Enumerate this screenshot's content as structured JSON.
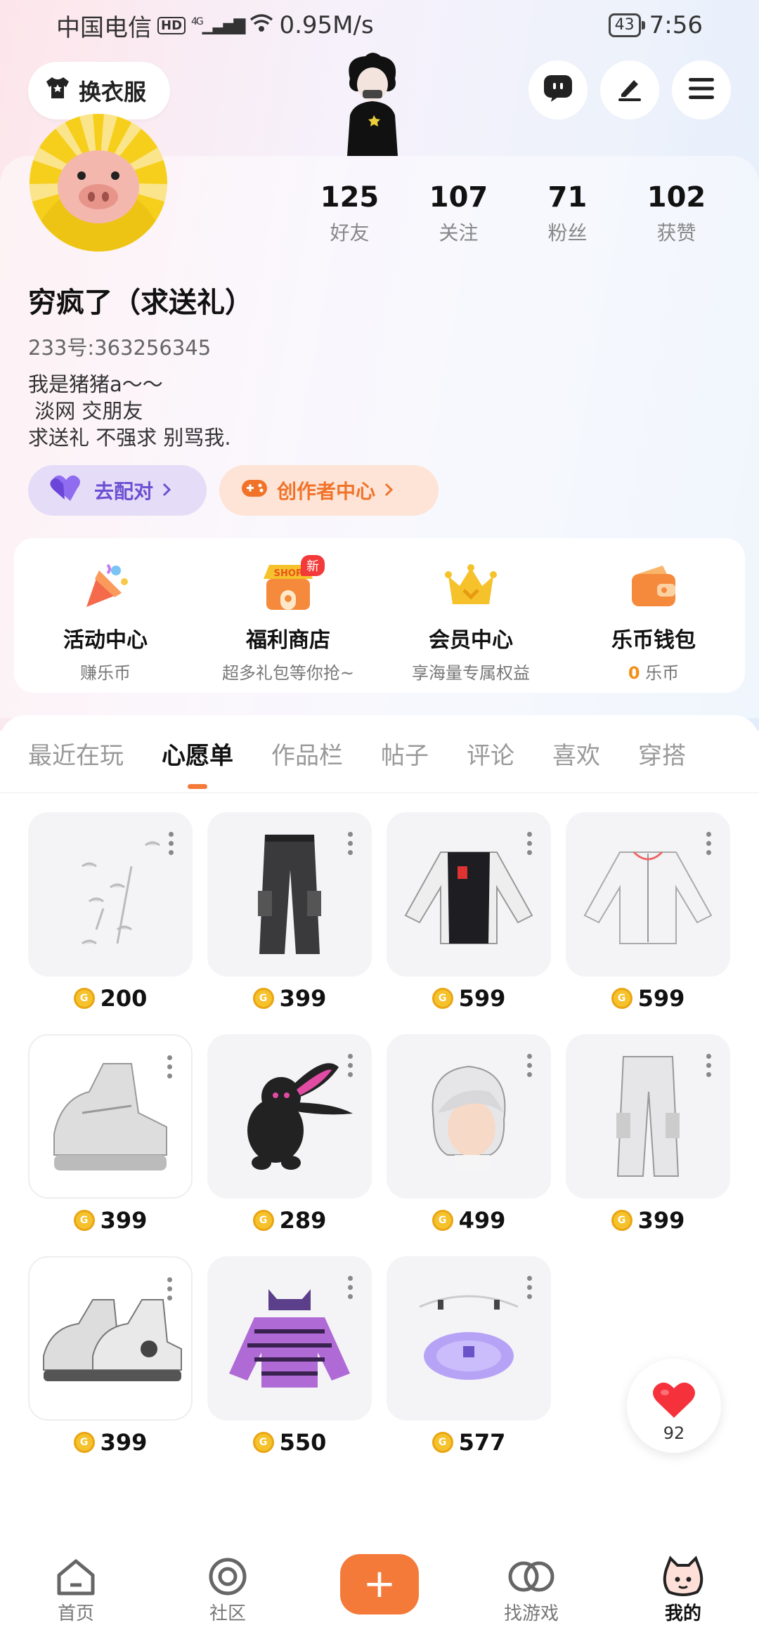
{
  "status_bar": {
    "carrier": "中国电信",
    "hd": "HD",
    "network": "4G",
    "speed": "0.95M/s",
    "battery": "43",
    "time": "7:56"
  },
  "header": {
    "wardrobe_label": "换衣服"
  },
  "profile": {
    "nickname": "穷疯了（求送礼）",
    "uid": "233号:363256345",
    "bio": "我是猪猪a～～\n 淡网 交朋友\n求送礼 不强求 别骂我.",
    "stats": [
      {
        "num": "125",
        "label": "好友"
      },
      {
        "num": "107",
        "label": "关注"
      },
      {
        "num": "71",
        "label": "粉丝"
      },
      {
        "num": "102",
        "label": "获赞"
      }
    ],
    "match_label": "去配对",
    "creator_label": "创作者中心"
  },
  "quick_panel": [
    {
      "title": "活动中心",
      "sub": "赚乐币",
      "icon": "party-popper-icon"
    },
    {
      "title": "福利商店",
      "sub": "超多礼包等你抢~",
      "icon": "shop-icon",
      "badge": "新",
      "badge_icon_text": "SHOP"
    },
    {
      "title": "会员中心",
      "sub": "享海量专属权益",
      "icon": "crown-icon"
    },
    {
      "title": "乐币钱包",
      "sub_num": "0",
      "sub_unit": " 乐币",
      "icon": "wallet-icon"
    }
  ],
  "tabs": [
    "最近在玩",
    "心愿单",
    "作品栏",
    "帖子",
    "评论",
    "喜欢",
    "穿搭"
  ],
  "active_tab": "心愿单",
  "coin_symbol": "G",
  "wishlist": [
    {
      "item": "accessory-set",
      "price": "200"
    },
    {
      "item": "black-pants",
      "price": "399"
    },
    {
      "item": "black-white-jacket",
      "price": "599"
    },
    {
      "item": "white-jacket",
      "price": "599"
    },
    {
      "item": "white-sneakers",
      "price": "399"
    },
    {
      "item": "bunny-plush",
      "price": "289"
    },
    {
      "item": "white-hair",
      "price": "499"
    },
    {
      "item": "white-cargo-pants",
      "price": "399"
    },
    {
      "item": "grey-sneakers",
      "price": "399"
    },
    {
      "item": "purple-striped-hoodie",
      "price": "550"
    },
    {
      "item": "purple-magic-circle",
      "price": "577"
    }
  ],
  "like_float": {
    "count": "92"
  },
  "bottom_nav": [
    {
      "label": "首页",
      "icon": "home-icon"
    },
    {
      "label": "社区",
      "icon": "community-icon"
    },
    {
      "label": "",
      "icon": "plus-icon"
    },
    {
      "label": "找游戏",
      "icon": "games-icon"
    },
    {
      "label": "我的",
      "icon": "profile-mascot-icon"
    }
  ],
  "colors": {
    "accent": "#f47a3a",
    "match_purple": "#6d4fd3",
    "coin_gold": "#f6c22b"
  }
}
